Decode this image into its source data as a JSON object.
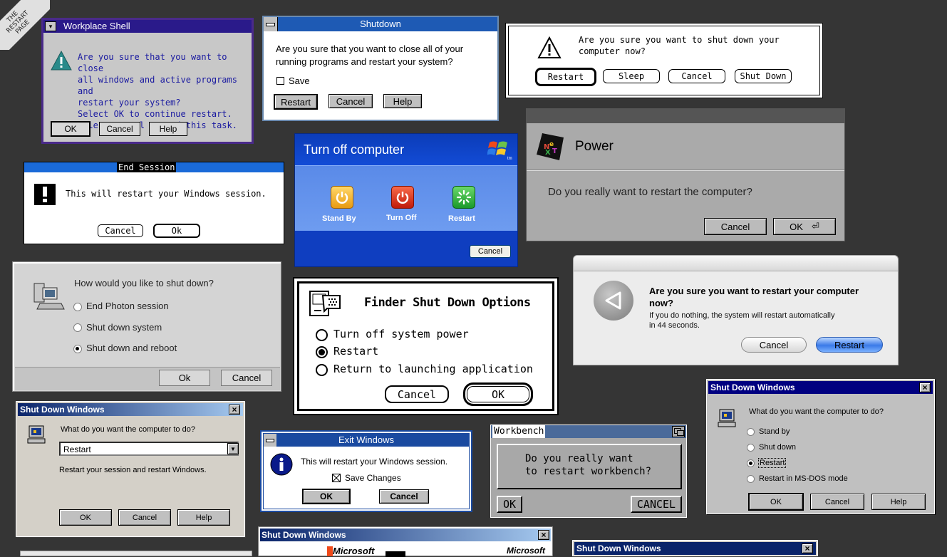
{
  "corner_label": "THE RESTART PAGE",
  "os2": {
    "title": "Workplace Shell",
    "lines": [
      "Are you sure that you want to close",
      "all windows and active programs and",
      "restart your system?",
      "Select OK to continue restart.",
      "Select Cancel to end this task."
    ],
    "ok": "OK",
    "cancel": "Cancel",
    "help": "Help"
  },
  "shutdown31": {
    "title": "Shutdown",
    "lines": [
      "Are you sure that you want to close all of your",
      "running programs and restart your system?"
    ],
    "save": "Save",
    "restart": "Restart",
    "cancel": "Cancel",
    "help": "Help"
  },
  "mac_alert": {
    "lines": [
      "Are you sure you want to shut down your",
      "computer now?"
    ],
    "restart": "Restart",
    "sleep": "Sleep",
    "cancel": "Cancel",
    "shutdown": "Shut Down"
  },
  "end_session": {
    "title": "End Session",
    "message": "This will restart your Windows session.",
    "cancel": "Cancel",
    "ok": "Ok"
  },
  "xp": {
    "title": "Turn off computer",
    "standby": "Stand By",
    "turnoff": "Turn Off",
    "restart": "Restart",
    "cancel": "Cancel",
    "logo_sub": "tm"
  },
  "next": {
    "title": "Power",
    "message": "Do you really want to restart the computer?",
    "cancel": "Cancel",
    "ok": "OK"
  },
  "photon": {
    "question": "How would you like to shut down?",
    "options": [
      "End Photon session",
      "Shut down system",
      "Shut down and reboot"
    ],
    "ok": "Ok",
    "cancel": "Cancel"
  },
  "finder": {
    "title": "Finder Shut Down Options",
    "options": [
      "Turn off system power",
      "Restart",
      "Return to launching application"
    ],
    "cancel": "Cancel",
    "ok": "OK"
  },
  "aqua": {
    "heading_lines": [
      "Are you sure you want to restart your computer",
      "now?"
    ],
    "sub_lines": [
      "If you do nothing, the system will restart automatically",
      "in 44 seconds."
    ],
    "cancel": "Cancel",
    "restart": "Restart"
  },
  "w98a": {
    "title": "Shut Down Windows",
    "question": "What do you want the computer to do?",
    "selected": "Restart",
    "desc": "Restart your session and restart Windows.",
    "ok": "OK",
    "cancel": "Cancel",
    "help": "Help"
  },
  "exitwin": {
    "title": "Exit Windows",
    "message": "This will restart your Windows session.",
    "save": "Save Changes",
    "ok": "OK",
    "cancel": "Cancel"
  },
  "workbench": {
    "title": "Workbench",
    "lines": [
      "Do you really want",
      "to restart workbench?"
    ],
    "ok": "OK",
    "cancel": "CANCEL"
  },
  "w95b": {
    "title": "Shut Down Windows",
    "question": "What do you want the computer to do?",
    "options": [
      "Stand by",
      "Shut down",
      "Restart",
      "Restart in MS-DOS mode"
    ],
    "ok": "OK",
    "cancel": "Cancel",
    "help": "Help"
  },
  "w98c": {
    "title": "Shut Down Windows",
    "brand_left": "Microsoft",
    "brand_right": "Microsoft"
  },
  "w98d": {
    "title": "Shut Down Windows"
  }
}
